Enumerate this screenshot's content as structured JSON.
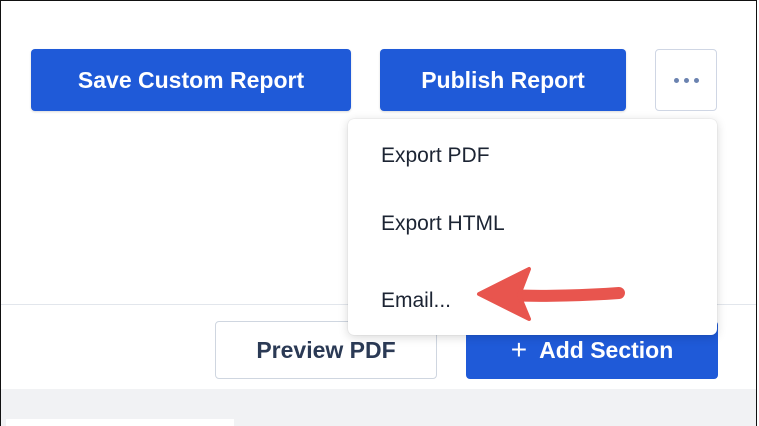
{
  "toolbar": {
    "save_label": "Save Custom Report",
    "publish_label": "Publish Report",
    "more_icon": "more-horizontal-icon"
  },
  "menu": {
    "items": [
      {
        "label": "Export PDF"
      },
      {
        "label": "Export HTML"
      },
      {
        "label": "Email..."
      }
    ]
  },
  "actions": {
    "preview_label": "Preview PDF",
    "add_section_icon": "+",
    "add_section_label": "Add Section"
  },
  "colors": {
    "primary": "#1f5ad8",
    "annotation_arrow": "#e8554e",
    "bottom_background": "#f1f2f4"
  }
}
